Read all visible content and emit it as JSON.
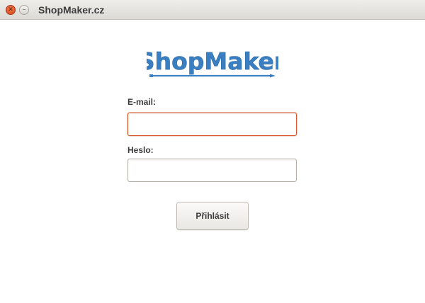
{
  "window": {
    "title": "ShopMaker.cz"
  },
  "logo": {
    "text": "ShopMaker",
    "color": "#3a7fc1"
  },
  "form": {
    "email_label": "E-mail:",
    "email_value": "",
    "password_label": "Heslo:",
    "password_value": "",
    "submit_label": "Přihlásit"
  },
  "colors": {
    "focus_border": "#d4572b",
    "close_button": "#e0552a"
  },
  "icons": {
    "close": "close-icon",
    "minimize": "minimize-icon",
    "pencil": "pencil-icon"
  }
}
